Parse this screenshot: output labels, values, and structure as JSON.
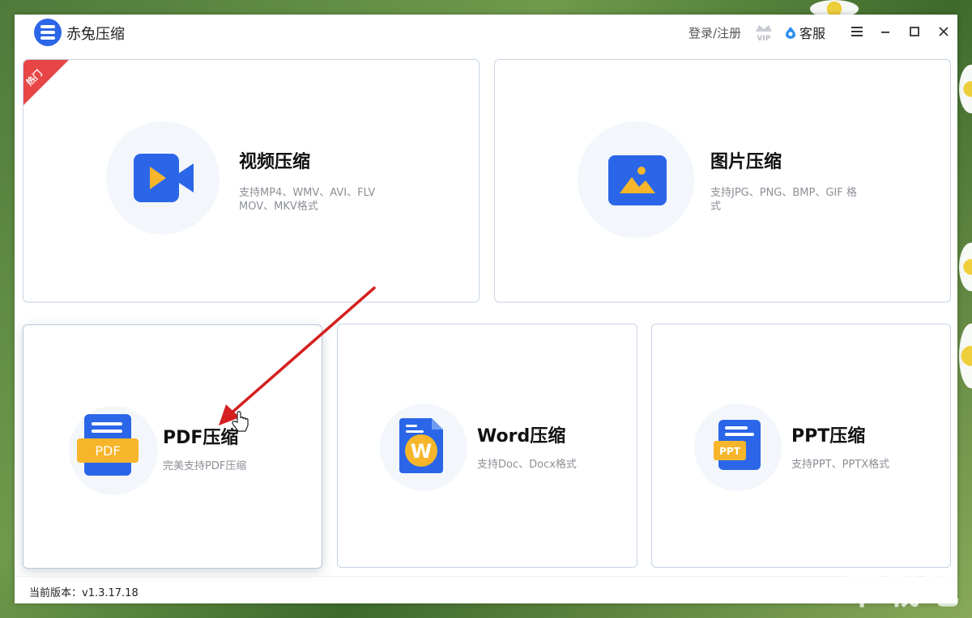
{
  "app": {
    "title": "赤兔压缩",
    "login_label": "登录/注册",
    "vip_label": "VIP",
    "service_label": "客服",
    "version_text": "当前版本：v1.3.17.18"
  },
  "cards": {
    "video": {
      "title": "视频压缩",
      "desc_line1": "支持MP4、WMV、AVI、FLV",
      "desc_line2": "MOV、MKV格式",
      "badge": "热门"
    },
    "image": {
      "title": "图片压缩",
      "desc_line1": "支持JPG、PNG、BMP、GIF 格",
      "desc_line2": "式"
    },
    "pdf": {
      "title": "PDF压缩",
      "desc": "完美支持PDF压缩",
      "icon_text": "PDF"
    },
    "word": {
      "title": "Word压缩",
      "desc": "支持Doc、Docx格式",
      "icon_text": "W"
    },
    "ppt": {
      "title": "PPT压缩",
      "desc": "支持PPT、PPTX格式",
      "icon_text": "PPT"
    }
  },
  "icons": {
    "menu": "menu-icon",
    "minimize": "minimize-icon",
    "maximize": "maximize-icon",
    "close": "close-icon",
    "video": "video-camera-icon",
    "image": "image-icon",
    "pdf": "pdf-document-icon",
    "word": "word-document-icon",
    "ppt": "ppt-document-icon"
  },
  "colors": {
    "accent": "#2b66e8",
    "badge": "#e84646",
    "doc_yellow": "#f6b52a",
    "annotation_arrow": "#d42020"
  },
  "watermark": "下载吧"
}
